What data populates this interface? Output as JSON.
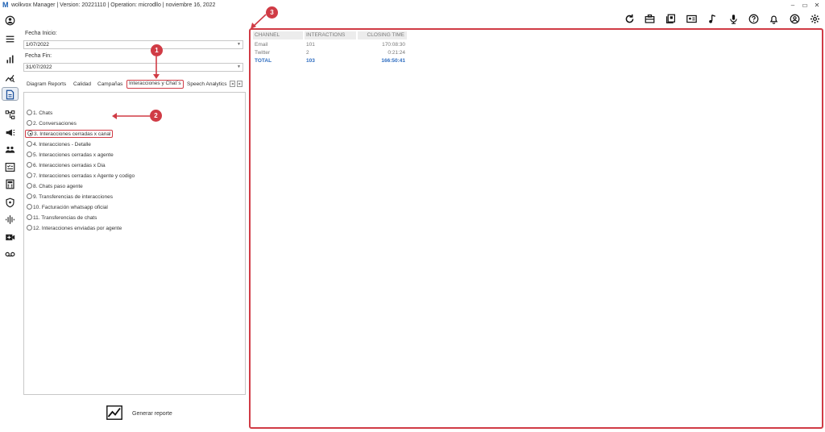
{
  "window": {
    "title": "wolkvox Manager  | Version: 20221110 |  Operation: microdllo | noviembre 16, 2022",
    "logo_letter": "M",
    "minimize": "–",
    "restore": "▭",
    "close": "✕"
  },
  "toolbar": {
    "icons": [
      "refresh-icon",
      "briefcase-icon",
      "book-icon",
      "id-card-icon",
      "music-note-icon",
      "microphone-icon",
      "help-icon",
      "bell-icon",
      "user-icon",
      "settings-icon"
    ]
  },
  "rail": {
    "icons": [
      "user-icon",
      "menu-icon",
      "bar-chart-icon",
      "analytics-icon",
      "report-icon",
      "flow-icon",
      "campaign-icon",
      "group-icon",
      "checklist-icon",
      "calculator-icon",
      "shield-icon",
      "audio-wave-icon",
      "video-add-icon",
      "voicemail-icon"
    ]
  },
  "filters": {
    "start_label": "Fecha Inicio:",
    "start_value": "1/07/2022",
    "end_label": "Fecha Fin:",
    "end_value": "31/07/2022"
  },
  "tabs": [
    "Diagram Reports",
    "Calidad",
    "Campañas",
    "Interacciones y Chat´s",
    "Speech Analytics"
  ],
  "tab_nav": {
    "prev": "◂",
    "next": "▸"
  },
  "reports": [
    "1. Chats",
    "2. Conversaciones",
    "3. Interacciones cerradas x canal",
    "4. Interacciones - Detalle",
    "5. Interacciones cerradas x agente",
    "6. Interacciones cerradas x Dia",
    "7. Interacciones cerradas x Agente y codigo",
    "8. Chats paso agente",
    "9. Transferencias de interacciones",
    "10. Facturación whatsapp oficial",
    "11. Transferencias de chats",
    "12. Interacciones enviadas por agente"
  ],
  "selected_report": 2,
  "generate_label": "Generar reporte",
  "table": {
    "headers": [
      "CHANNEL",
      "INTERACTIONS",
      "CLOSING TIME"
    ],
    "rows": [
      [
        "Email",
        "101",
        "170:08:30"
      ],
      [
        "Twitter",
        "2",
        "0:21:24"
      ],
      [
        "TOTAL",
        "103",
        "166:50:41"
      ]
    ]
  },
  "annotations": [
    "1",
    "2",
    "3"
  ],
  "colors": {
    "accent_red": "#d03b45",
    "total_blue": "#2d6cc0",
    "header_gray": "#ececec"
  }
}
